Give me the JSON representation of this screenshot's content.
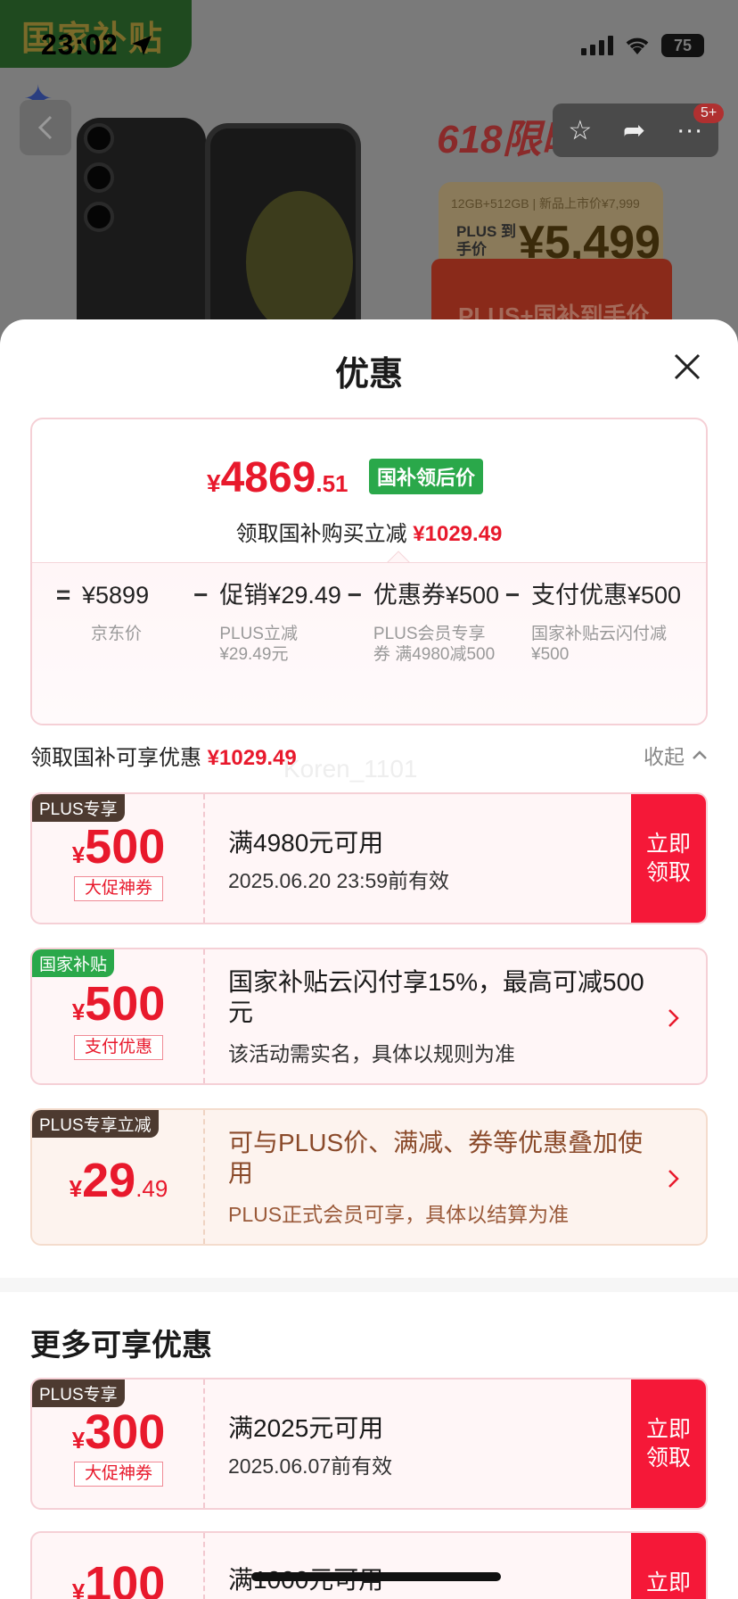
{
  "status_bar": {
    "time": "23:02",
    "battery": "75"
  },
  "background_page": {
    "subsidy_tag": "国家补贴",
    "promo_title": "618限时抢购",
    "notification_badge": "5+",
    "price_card": {
      "spec_line": "12GB+512GB | 新品上市价¥7,999",
      "plus_label": "PLUS 到手价",
      "price": "¥5,499"
    },
    "red_band_text": "PLUS+国补到手价"
  },
  "sheet": {
    "title": "优惠",
    "summary": {
      "price_yen": "¥",
      "price_int": "4869",
      "price_dec": ".51",
      "price_tag": "国补领后价",
      "subtitle_prefix": "领取国补购买立减",
      "subtitle_amount": "¥1029.49",
      "formula": [
        {
          "op": "=",
          "amount": "¥5899",
          "note": "京东价"
        },
        {
          "op": "−",
          "amount": "促销¥29.49",
          "note": "PLUS立减 ¥29.49元"
        },
        {
          "op": "−",
          "amount": "优惠券¥500",
          "note": "PLUS会员专享券 满4980减500"
        },
        {
          "op": "−",
          "amount": "支付优惠¥500",
          "note": "国家补贴云闪付减 ¥500"
        }
      ]
    },
    "section": {
      "label": "领取国补可享优惠",
      "amount": "¥1029.49",
      "collapse": "收起"
    },
    "watermark": "Koren_1101",
    "coupons": [
      {
        "badge": "PLUS专享",
        "yen": "¥",
        "amount": "500",
        "chip": "大促神券",
        "title": "满4980元可用",
        "subtitle": "2025.06.20 23:59前有效",
        "button": "立即领取"
      },
      {
        "badge": "国家补贴",
        "yen": "¥",
        "amount": "500",
        "chip": "支付优惠",
        "title": "国家补贴云闪付享15%，最高可减500元",
        "subtitle": "该活动需实名，具体以规则为准"
      },
      {
        "badge": "PLUS专享立减",
        "yen": "¥",
        "amount": "29",
        "decimal": ".49",
        "title": "可与PLUS价、满减、券等优惠叠加使用",
        "subtitle": "PLUS正式会员可享，具体以结算为准"
      }
    ],
    "more_title": "更多可享优惠",
    "more_coupons": [
      {
        "badge": "PLUS专享",
        "yen": "¥",
        "amount": "300",
        "chip": "大促神券",
        "title": "满2025元可用",
        "subtitle": "2025.06.07前有效",
        "button": "立即领取"
      },
      {
        "yen": "¥",
        "amount": "100",
        "title": "满1000元可用",
        "button": "立即"
      }
    ]
  }
}
